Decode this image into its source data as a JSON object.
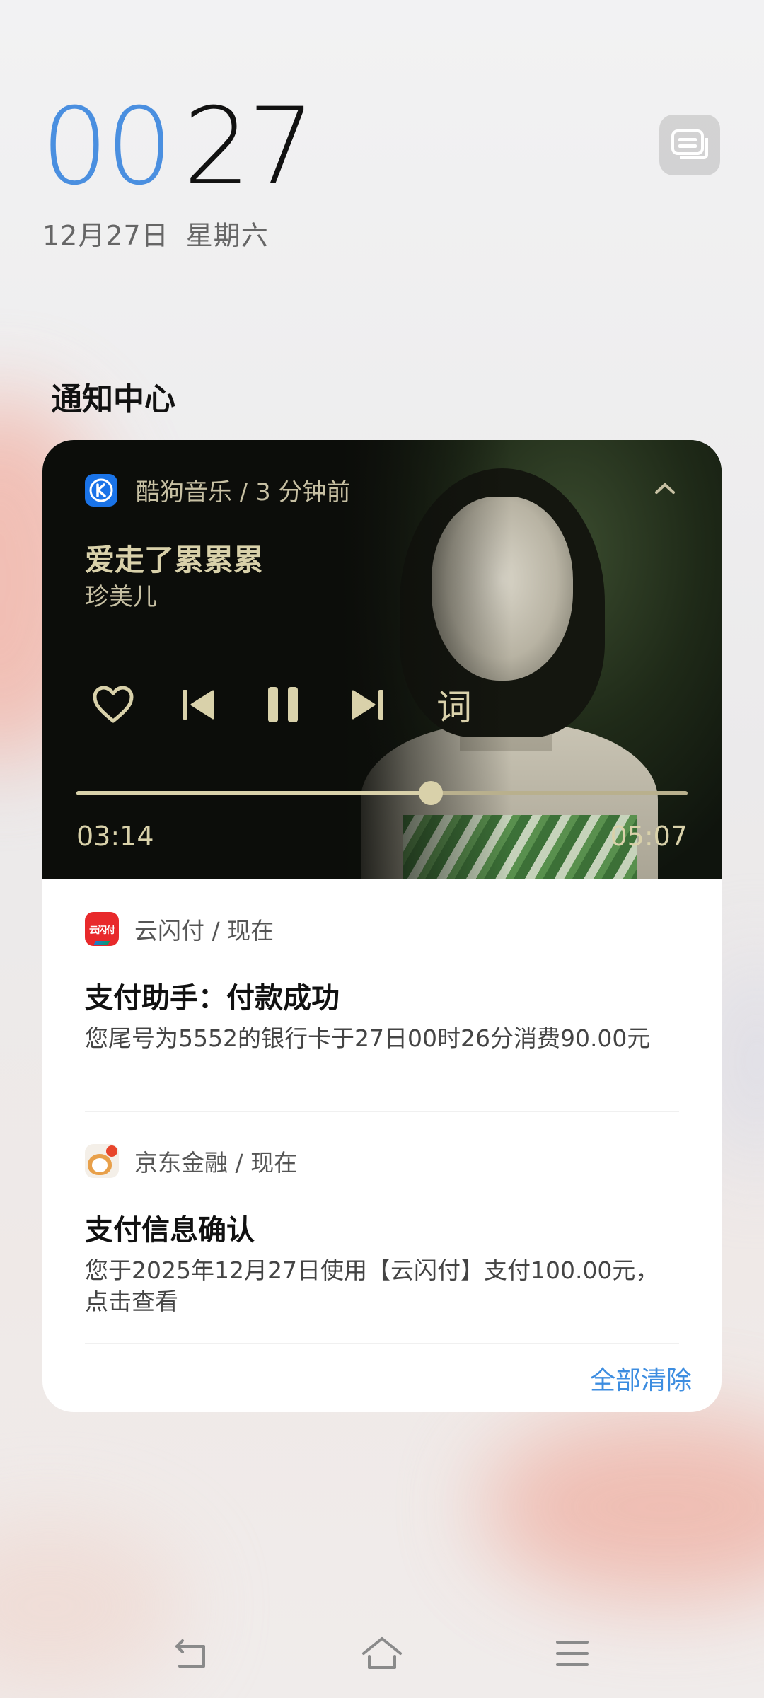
{
  "clock": {
    "hour": "00",
    "minute": "27"
  },
  "date": {
    "day": "12月27日",
    "weekday": "星期六"
  },
  "notification_center": {
    "title": "通知中心",
    "clear_all": "全部清除"
  },
  "media": {
    "app": "酷狗音乐 / 3 分钟前",
    "song": "爱走了累累累",
    "artist": "珍美儿",
    "lyrics_label": "词",
    "current_time": "03:14",
    "total_time": "05:07",
    "progress": 0.58,
    "icons": [
      "collapse-chevron-icon",
      "heart-icon",
      "previous-icon",
      "pause-icon",
      "next-icon"
    ]
  },
  "notifications": [
    {
      "app": "云闪付 / 现在",
      "title": "支付助手：付款成功",
      "body": "您尾号为5552的银行卡于27日00时26分消费90.00元"
    },
    {
      "app": "京东金融 / 现在",
      "title": "支付信息确认",
      "body": "您于2025年12月27日使用【云闪付】支付100.00元，点击查看"
    }
  ],
  "colors": {
    "accent": "#4a8fe0",
    "media_text": "#d9d1aa",
    "link": "#3d8de0"
  }
}
